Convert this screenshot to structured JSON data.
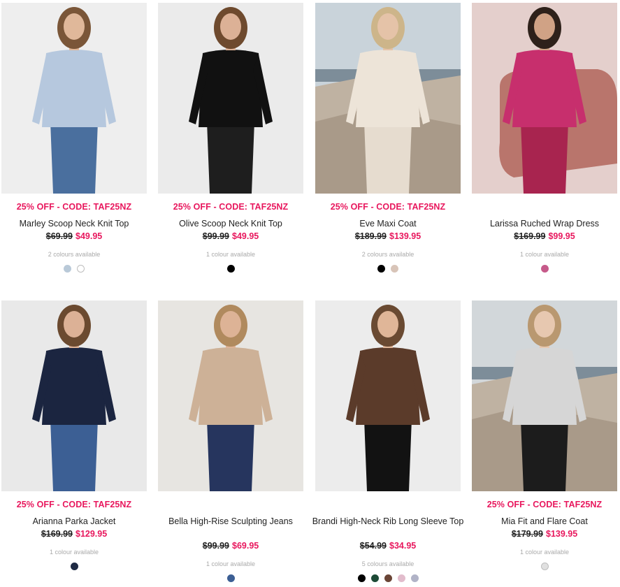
{
  "products": [
    {
      "id": "marley",
      "promo": "25% OFF - CODE: TAF25NZ",
      "name": "Marley Scoop Neck Knit Top",
      "was": "$69.99",
      "now": "$49.95",
      "colours_text": "2 colours available",
      "swatches": [
        "#b9c9d8",
        "#ffffff"
      ],
      "image": {
        "bg": "#eeeeee",
        "skin": "#e0b89a",
        "hair": "#7a5638",
        "top": "#b6c8de",
        "bottom": "#4a6f9e",
        "scene": "studio"
      }
    },
    {
      "id": "olive",
      "promo": "25% OFF - CODE: TAF25NZ",
      "name": "Olive Scoop Neck Knit Top",
      "was": "$99.99",
      "now": "$49.95",
      "colours_text": "1 colour available",
      "swatches": [
        "#000000"
      ],
      "image": {
        "bg": "#ebebeb",
        "skin": "#dcb196",
        "hair": "#6e4a2e",
        "top": "#111111",
        "bottom": "#1e1e1e",
        "scene": "studio"
      }
    },
    {
      "id": "eve",
      "promo": "25% OFF - CODE: TAF25NZ",
      "name": "Eve Maxi Coat",
      "was": "$189.99",
      "now": "$139.95",
      "colours_text": "2 colours available",
      "swatches": [
        "#000000",
        "#d8c4b8"
      ],
      "image": {
        "bg": "#c9d3da",
        "skin": "#e5c3a8",
        "hair": "#cdb58a",
        "top": "#ede4d8",
        "bottom": "#e6dccf",
        "scene": "coast"
      }
    },
    {
      "id": "larissa",
      "promo": "",
      "name": "Larissa Ruched Wrap Dress",
      "was": "$169.99",
      "now": "$99.95",
      "colours_text": "1 colour available",
      "swatches": [
        "#c65a8a"
      ],
      "image": {
        "bg": "#e4cfcc",
        "skin": "#d0a285",
        "hair": "#2e211a",
        "top": "#c72f6d",
        "bottom": "#a8244f",
        "scene": "chair"
      }
    },
    {
      "id": "arianna",
      "promo": "25% OFF - CODE: TAF25NZ",
      "name": "Arianna Parka Jacket",
      "was": "$169.99",
      "now": "$129.95",
      "colours_text": "1 colour available",
      "swatches": [
        "#1f2a44"
      ],
      "image": {
        "bg": "#e9e9e9",
        "skin": "#dcb196",
        "hair": "#6b4a30",
        "top": "#1b2540",
        "bottom": "#3c5f94",
        "scene": "studio"
      }
    },
    {
      "id": "bella",
      "promo": "",
      "name": "Bella High-Rise Sculpting Jeans",
      "was": "$99.99",
      "now": "$69.95",
      "colours_text": "1 colour available",
      "swatches": [
        "#3c5f94"
      ],
      "image": {
        "bg": "#e7e5e1",
        "skin": "#ddb396",
        "hair": "#b08a5e",
        "top": "#cdb197",
        "bottom": "#26355e",
        "scene": "studio"
      }
    },
    {
      "id": "brandi",
      "promo": "",
      "name": "Brandi High-Neck Rib Long Sleeve Top",
      "was": "$54.99",
      "now": "$34.95",
      "colours_text": "5 colours available",
      "swatches": [
        "#000000",
        "#1d4a36",
        "#6a4536",
        "#e2bccc",
        "#b1b3c7"
      ],
      "image": {
        "bg": "#ececec",
        "skin": "#e0b698",
        "hair": "#6a4a32",
        "top": "#5b3b2a",
        "bottom": "#121212",
        "scene": "studio"
      }
    },
    {
      "id": "mia",
      "promo": "25% OFF - CODE: TAF25NZ",
      "name": "Mia Fit and Flare Coat",
      "was": "$179.99",
      "now": "$139.95",
      "colours_text": "1 colour available",
      "swatches": [
        "#e0e0e0"
      ],
      "image": {
        "bg": "#d2d7da",
        "skin": "#e7c8b0",
        "hair": "#b99870",
        "top": "#d6d6d6",
        "bottom": "#1c1c1c",
        "scene": "coast"
      }
    }
  ]
}
